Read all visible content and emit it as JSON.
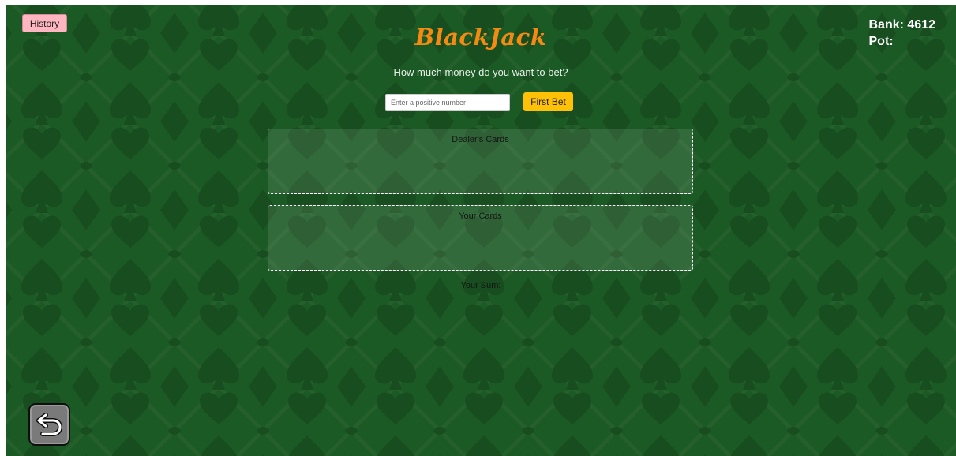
{
  "history": {
    "label": "History"
  },
  "stats": {
    "bank_label": "Bank:",
    "bank_value": "4612",
    "pot_label": "Pot:",
    "pot_value": ""
  },
  "title": "BlackJack",
  "bet": {
    "question": "How much money do you want to bet?",
    "placeholder": "Enter a positive number",
    "button_label": "First Bet"
  },
  "dealer": {
    "label": "Dealer's Cards"
  },
  "player": {
    "label": "Your Cards",
    "sum_label": "Your Sum:",
    "sum_value": ""
  },
  "icons": {
    "back": "undo-arrow-icon",
    "background": "card-suits-pattern"
  },
  "colors": {
    "felt": "#1c5a25",
    "title": "#f58a13",
    "history_button": "#ffb6c1",
    "bet_button": "#ffc107"
  }
}
